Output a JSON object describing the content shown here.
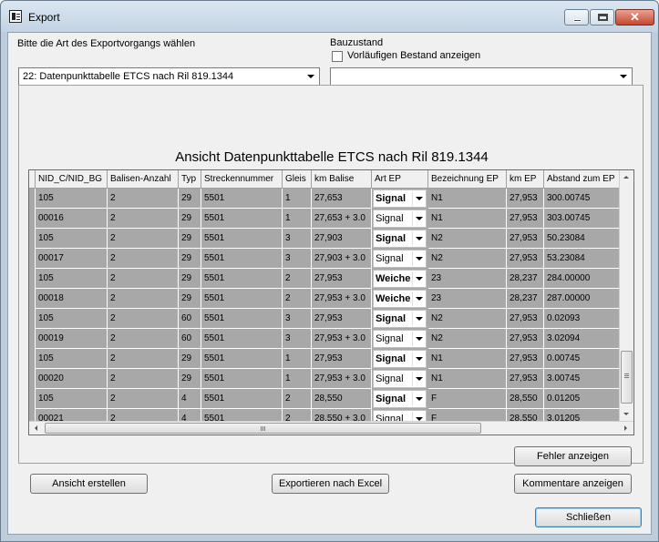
{
  "window": {
    "title": "Export",
    "icon": "app-document-icon"
  },
  "form": {
    "export_type_label": "Bitte die Art des Exportvorgangs wählen",
    "export_type_value": "22: Datenpunkttabelle ETCS nach Ril 819.1344",
    "bauzustand_label": "Bauzustand",
    "preliminary_checkbox_label": "Vorläufigen Bestand anzeigen",
    "preliminary_checked": false,
    "bauzustand_value": ""
  },
  "view": {
    "title": "Ansicht Datenpunkttabelle ETCS nach Ril 819.1344"
  },
  "table": {
    "columns": [
      "NID_C/NID_BG",
      "Balisen-Anzahl",
      "Typ",
      "Streckennummer",
      "Gleis",
      "km Balise",
      "Art EP",
      "Bezeichnung EP",
      "km EP",
      "Abstand zum EP"
    ],
    "rows": [
      [
        "105",
        "2",
        "29",
        "5501",
        "1",
        "27,653",
        "Signal",
        "N1",
        "27,953",
        "300.00745"
      ],
      [
        "00016",
        "2",
        "29",
        "5501",
        "1",
        "27,653 + 3.0",
        "Signal",
        "N1",
        "27,953",
        "303.00745"
      ],
      [
        "105",
        "2",
        "29",
        "5501",
        "3",
        "27,903",
        "Signal",
        "N2",
        "27,953",
        "50.23084"
      ],
      [
        "00017",
        "2",
        "29",
        "5501",
        "3",
        "27,903 + 3.0",
        "Signal",
        "N2",
        "27,953",
        "53.23084"
      ],
      [
        "105",
        "2",
        "29",
        "5501",
        "2",
        "27,953",
        "Weiche",
        "23",
        "28,237",
        "284.00000"
      ],
      [
        "00018",
        "2",
        "29",
        "5501",
        "2",
        "27,953 + 3.0",
        "Weiche",
        "23",
        "28,237",
        "287.00000"
      ],
      [
        "105",
        "2",
        "60",
        "5501",
        "3",
        "27,953",
        "Signal",
        "N2",
        "27,953",
        "0.02093"
      ],
      [
        "00019",
        "2",
        "60",
        "5501",
        "3",
        "27,953 + 3.0",
        "Signal",
        "N2",
        "27,953",
        "3.02094"
      ],
      [
        "105",
        "2",
        "29",
        "5501",
        "1",
        "27,953",
        "Signal",
        "N1",
        "27,953",
        "0.00745"
      ],
      [
        "00020",
        "2",
        "29",
        "5501",
        "1",
        "27,953 + 3.0",
        "Signal",
        "N1",
        "27,953",
        "3.00745"
      ],
      [
        "105",
        "2",
        "4",
        "5501",
        "2",
        "28,550",
        "Signal",
        "F",
        "28,550",
        "0.01205"
      ],
      [
        "00021",
        "2",
        "4",
        "5501",
        "2",
        "28,550 + 3.0",
        "Signal",
        "F",
        "28,550",
        "3.01205"
      ]
    ],
    "bold_art_rows": [
      0,
      2,
      4,
      5,
      6,
      8,
      10
    ]
  },
  "buttons": {
    "show_errors": "Fehler anzeigen",
    "create_view": "Ansicht erstellen",
    "export_excel": "Exportieren nach Excel",
    "show_comments": "Kommentare anzeigen",
    "close": "Schließen"
  }
}
